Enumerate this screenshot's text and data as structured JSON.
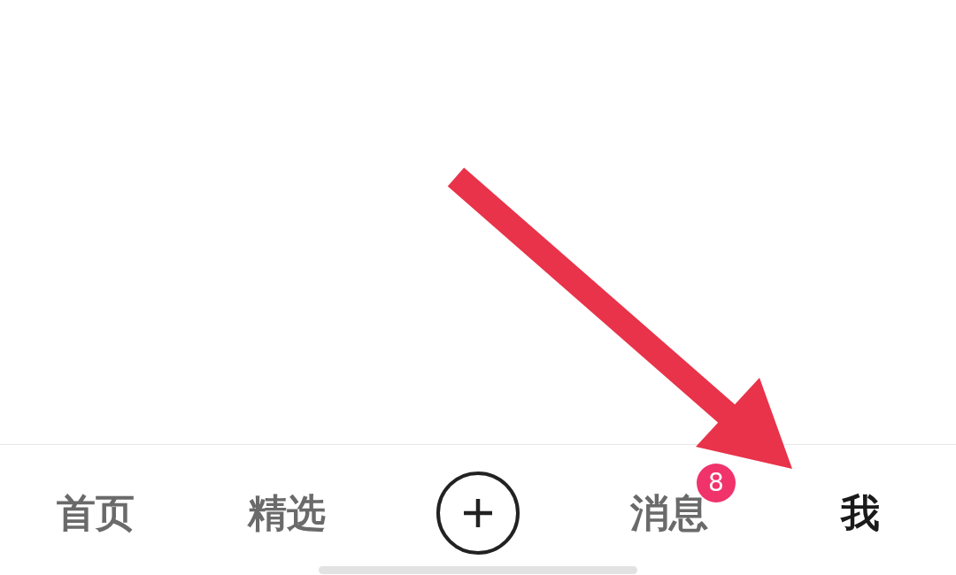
{
  "tab_bar": {
    "tabs": [
      {
        "kind": "text",
        "label": "首页",
        "selected": false
      },
      {
        "kind": "text",
        "label": "精选",
        "selected": false
      },
      {
        "kind": "add"
      },
      {
        "kind": "text",
        "label": "消息",
        "selected": false,
        "badge": "8"
      },
      {
        "kind": "text",
        "label": "我",
        "selected": true
      }
    ]
  }
}
